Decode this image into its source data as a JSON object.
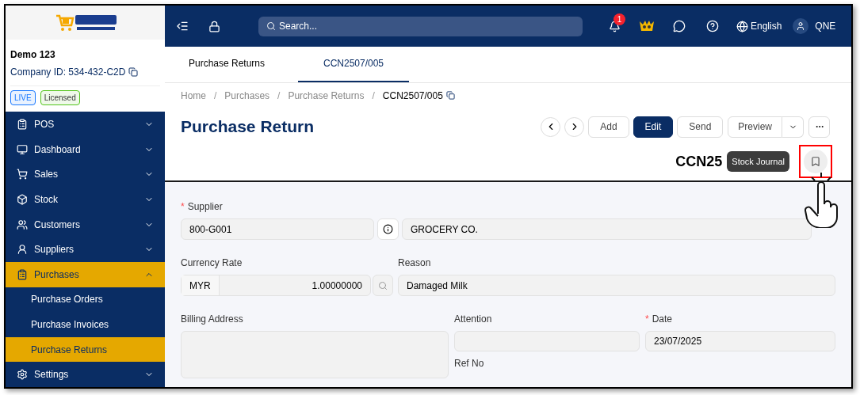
{
  "sidebar": {
    "company_name": "Demo 123",
    "company_id": "Company ID: 534-432-C2D",
    "badges": [
      {
        "label": "LIVE",
        "color": "#1677ff"
      },
      {
        "label": "Licensed",
        "color": "#52c41a"
      }
    ],
    "items": [
      {
        "label": "POS",
        "expanded": false,
        "selected": false
      },
      {
        "label": "Dashboard",
        "expanded": false,
        "selected": false
      },
      {
        "label": "Sales",
        "expanded": false,
        "selected": false
      },
      {
        "label": "Stock",
        "expanded": false,
        "selected": false
      },
      {
        "label": "Customers",
        "expanded": false,
        "selected": false
      },
      {
        "label": "Suppliers",
        "expanded": false,
        "selected": false
      },
      {
        "label": "Purchases",
        "expanded": true,
        "selected": true,
        "children": [
          {
            "label": "Purchase Orders",
            "selected": false
          },
          {
            "label": "Purchase Invoices",
            "selected": false
          },
          {
            "label": "Purchase Returns",
            "selected": true
          }
        ]
      },
      {
        "label": "Settings",
        "expanded": false,
        "selected": false
      }
    ]
  },
  "topbar": {
    "search": {
      "placeholder": "Search..."
    },
    "notification_count": "1",
    "language": "English",
    "user": "QNE"
  },
  "tabs": [
    {
      "label": "Purchase Returns",
      "selected": false
    },
    {
      "label": "CCN2507/005",
      "selected": true
    }
  ],
  "breadcrumb": [
    "Home",
    "Purchases",
    "Purchase Returns",
    "CCN2507/005"
  ],
  "breadcrumb_separator": "/",
  "required_mark": "*",
  "title": "Purchase Return",
  "actions": [
    "Add",
    "Edit",
    "Send",
    "Preview"
  ],
  "doc_number": "CCN25",
  "tooltip": "Stock Journal",
  "form": {
    "supplier": {
      "label": "Supplier",
      "required": true,
      "code": "800-G001",
      "name": "GROCERY CO."
    },
    "currency_rate": {
      "label": "Currency Rate",
      "currency": "MYR",
      "value": "1.00000000"
    },
    "reason": {
      "label": "Reason",
      "value": "Damaged Milk"
    },
    "billing_address": {
      "label": "Billing Address"
    },
    "attention": {
      "label": "Attention"
    },
    "date": {
      "label": "Date",
      "required": true,
      "value": "23/07/2025"
    },
    "ref_no": {
      "label": "Ref No"
    }
  }
}
